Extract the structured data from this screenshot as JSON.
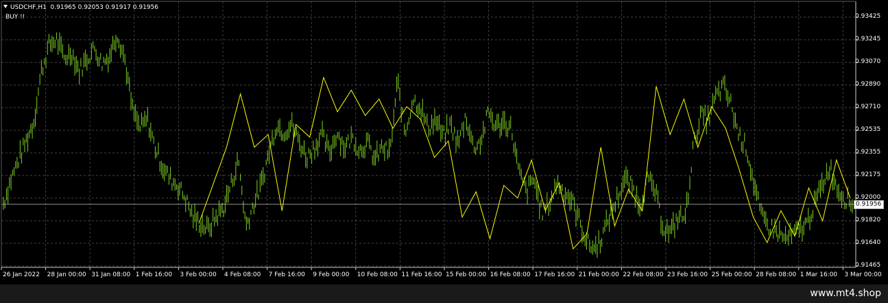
{
  "header": {
    "symbol_line": "USDCHF,H1  0.91965 0.92053 0.91917 0.91956",
    "signal_text": "BUY !!"
  },
  "footer": {
    "brand": "www.mt4.shop"
  },
  "colors": {
    "background": "#000000",
    "grid": "#5a5a5a",
    "candles": "#7fd321",
    "zigzag": "#ffff00",
    "text": "#ffffff"
  },
  "chart_data": {
    "type": "line",
    "symbol": "USDCHF",
    "timeframe": "H1",
    "current_price": "0.91956",
    "ylim": [
      0.914,
      0.935
    ],
    "y_ticks": [
      "0.93425",
      "0.93245",
      "0.93070",
      "0.92890",
      "0.92710",
      "0.92535",
      "0.92355",
      "0.92175",
      "0.92000",
      "0.91820",
      "0.91640",
      "0.91465"
    ],
    "x_ticks": [
      "26 Jan 2022",
      "28 Jan 00:00",
      "31 Jan 08:00",
      "1 Feb 16:00",
      "3 Feb 00:00",
      "4 Feb 08:00",
      "7 Feb 16:00",
      "9 Feb 00:00",
      "10 Feb 08:00",
      "11 Feb 16:00",
      "15 Feb 00:00",
      "16 Feb 08:00",
      "17 Feb 16:00",
      "21 Feb 00:00",
      "22 Feb 08:00",
      "23 Feb 16:00",
      "25 Feb 00:00",
      "28 Feb 08:00",
      "1 Mar 16:00",
      "3 Mar 00:00"
    ],
    "price_path": [
      0.9196,
      0.9215,
      0.923,
      0.9245,
      0.926,
      0.93,
      0.932,
      0.9325,
      0.931,
      0.9315,
      0.93,
      0.931,
      0.9318,
      0.9306,
      0.9312,
      0.933,
      0.931,
      0.927,
      0.9255,
      0.9262,
      0.924,
      0.9225,
      0.9215,
      0.921,
      0.92,
      0.9185,
      0.918,
      0.9175,
      0.9185,
      0.9192,
      0.921,
      0.923,
      0.9178,
      0.9195,
      0.921,
      0.9235,
      0.9258,
      0.9252,
      0.9258,
      0.9245,
      0.9232,
      0.924,
      0.925,
      0.9235,
      0.9252,
      0.924,
      0.9248,
      0.9238,
      0.9244,
      0.923,
      0.924,
      0.9235,
      0.9292,
      0.925,
      0.9278,
      0.9272,
      0.9255,
      0.9262,
      0.9248,
      0.9258,
      0.9242,
      0.9265,
      0.924,
      0.9245,
      0.9268,
      0.9256,
      0.926,
      0.9255,
      0.922,
      0.9205,
      0.9215,
      0.9188,
      0.9195,
      0.9212,
      0.9205,
      0.9198,
      0.9182,
      0.9165,
      0.916,
      0.917,
      0.9186,
      0.92,
      0.9215,
      0.9208,
      0.9195,
      0.9215,
      0.9205,
      0.9178,
      0.9172,
      0.9185,
      0.9185,
      0.924,
      0.9265,
      0.9262,
      0.928,
      0.9288,
      0.9274,
      0.925,
      0.924,
      0.9212,
      0.9185,
      0.9178,
      0.9174,
      0.9168,
      0.917,
      0.9175,
      0.918,
      0.9195,
      0.921,
      0.9225,
      0.9208,
      0.92,
      0.9196
    ],
    "zigzag": [
      [
        0,
        0.918
      ],
      [
        1,
        0.921
      ],
      [
        2,
        0.924
      ],
      [
        3,
        0.9282
      ],
      [
        4,
        0.924
      ],
      [
        5,
        0.925
      ],
      [
        6,
        0.919
      ],
      [
        7,
        0.9258
      ],
      [
        8,
        0.9248
      ],
      [
        9,
        0.9295
      ],
      [
        10,
        0.9268
      ],
      [
        11,
        0.9285
      ],
      [
        12,
        0.9265
      ],
      [
        13,
        0.9278
      ],
      [
        14,
        0.9255
      ],
      [
        15,
        0.9272
      ],
      [
        16,
        0.9262
      ],
      [
        17,
        0.9232
      ],
      [
        18,
        0.9245
      ],
      [
        19,
        0.9185
      ],
      [
        20,
        0.9205
      ],
      [
        21,
        0.9168
      ],
      [
        22,
        0.921
      ],
      [
        23,
        0.92
      ],
      [
        24,
        0.923
      ],
      [
        25,
        0.919
      ],
      [
        26,
        0.9212
      ],
      [
        27,
        0.916
      ],
      [
        28,
        0.9172
      ],
      [
        29,
        0.924
      ],
      [
        30,
        0.9178
      ],
      [
        31,
        0.9207
      ],
      [
        32,
        0.919
      ],
      [
        33,
        0.9288
      ],
      [
        34,
        0.925
      ],
      [
        35,
        0.9278
      ],
      [
        36,
        0.924
      ],
      [
        37,
        0.9272
      ],
      [
        38,
        0.9255
      ],
      [
        39,
        0.9222
      ],
      [
        40,
        0.9185
      ],
      [
        41,
        0.9165
      ],
      [
        42,
        0.919
      ],
      [
        43,
        0.917
      ],
      [
        44,
        0.9208
      ],
      [
        45,
        0.9182
      ],
      [
        46,
        0.923
      ],
      [
        47,
        0.92
      ]
    ]
  }
}
